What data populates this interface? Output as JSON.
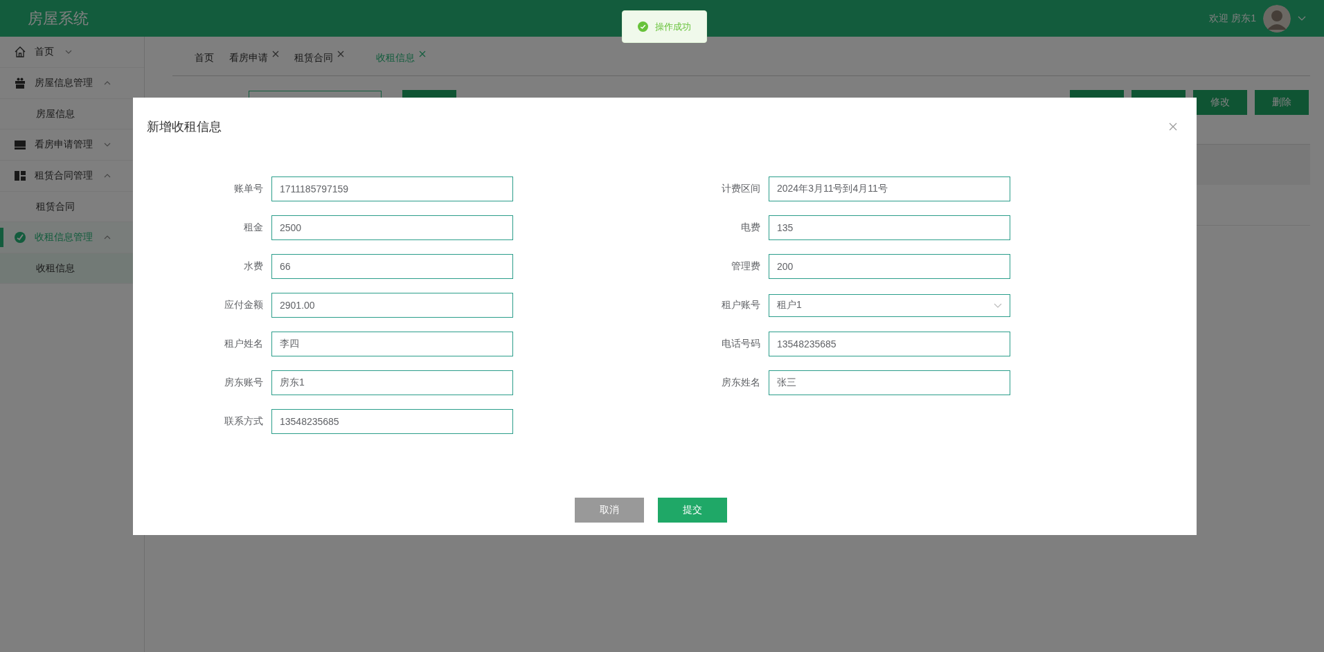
{
  "header": {
    "title": "房屋系统",
    "welcome": "欢迎 房东1"
  },
  "toast": {
    "message": "操作成功"
  },
  "sidebar": {
    "items": [
      {
        "label": "首页",
        "expanded": false,
        "selected": false
      },
      {
        "label": "房屋信息管理",
        "expanded": true,
        "selected": false,
        "children": [
          {
            "label": "房屋信息",
            "selected": false
          }
        ]
      },
      {
        "label": "看房申请管理",
        "expanded": false,
        "selected": false
      },
      {
        "label": "租赁合同管理",
        "expanded": true,
        "selected": false,
        "children": [
          {
            "label": "租赁合同",
            "selected": false
          }
        ]
      },
      {
        "label": "收租信息管理",
        "expanded": true,
        "selected": true,
        "children": [
          {
            "label": "收租信息",
            "selected": true
          }
        ]
      }
    ]
  },
  "tabs": [
    {
      "label": "首页",
      "closable": false,
      "selected": false
    },
    {
      "label": "看房申请",
      "closable": true,
      "selected": false
    },
    {
      "label": "租赁合同",
      "closable": true,
      "selected": false
    },
    {
      "label": "收租信息",
      "closable": true,
      "selected": true
    }
  ],
  "toolbar": {
    "buttons": [
      "修改",
      "删除"
    ]
  },
  "dialog": {
    "title": "新增收租信息",
    "fields": [
      {
        "label": "账单号",
        "value": "1711185797159",
        "kind": "input"
      },
      {
        "label": "计费区间",
        "value": "2024年3月11号到4月11号",
        "kind": "input"
      },
      {
        "label": "租金",
        "value": "2500",
        "kind": "input"
      },
      {
        "label": "电费",
        "value": "135",
        "kind": "input"
      },
      {
        "label": "水费",
        "value": "66",
        "kind": "input"
      },
      {
        "label": "管理费",
        "value": "200",
        "kind": "input"
      },
      {
        "label": "应付金额",
        "value": "2901.00",
        "kind": "input"
      },
      {
        "label": "租户账号",
        "value": "租户1",
        "kind": "select"
      },
      {
        "label": "租户姓名",
        "value": "李四",
        "kind": "input"
      },
      {
        "label": "电话号码",
        "value": "13548235685",
        "kind": "input"
      },
      {
        "label": "房东账号",
        "value": "房东1",
        "kind": "input"
      },
      {
        "label": "房东姓名",
        "value": "张三",
        "kind": "input"
      },
      {
        "label": "联系方式",
        "value": "13548235685",
        "kind": "input"
      }
    ],
    "buttons": [
      {
        "label": "取消",
        "kind": "cancel"
      },
      {
        "label": "提交",
        "kind": "primary"
      }
    ]
  }
}
